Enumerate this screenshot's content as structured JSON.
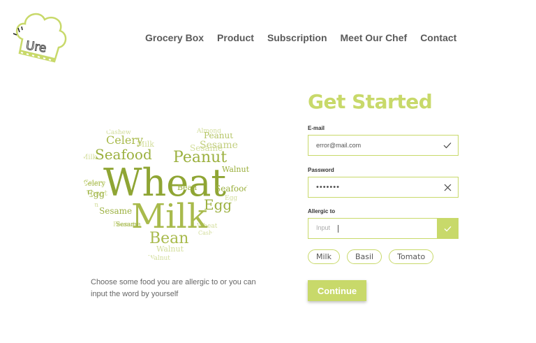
{
  "brand": {
    "logo_text": "Ure"
  },
  "nav": {
    "items": [
      "Grocery Box",
      "Product",
      "Subscription",
      "Meet Our Chef",
      "Contact"
    ]
  },
  "cloud": {
    "words": [
      "Wheat",
      "Milk",
      "Peanut",
      "Seafood",
      "Celery",
      "Bean",
      "Egg",
      "Walnut",
      "Sesame",
      "Cashew",
      "Almond",
      "Wheat",
      "Milk",
      "Peanut",
      "Celery",
      "Bean",
      "Egg",
      "Walnut",
      "Sesame",
      "Seafood",
      "Milk",
      "Egg",
      "Bean",
      "Peanut",
      "Wheat",
      "Celery",
      "Cashew",
      "Sesame",
      "Walnut"
    ]
  },
  "hint": {
    "text": "Choose some food you are allergic to or you can input the word by yourself"
  },
  "form": {
    "title": "Get Started",
    "email_label": "E-mail",
    "email_value": "error@mail.com",
    "password_label": "Password",
    "password_value": "•••••••",
    "allergic_label": "Allergic to",
    "allergic_placeholder": "Input",
    "chips": [
      "Milk",
      "Basil",
      "Tomato"
    ],
    "continue_label": "Continue"
  },
  "colors": {
    "accent": "#c8d96a",
    "cloud_dark": "#8fa534",
    "cloud_light": "#d2dd9a"
  }
}
